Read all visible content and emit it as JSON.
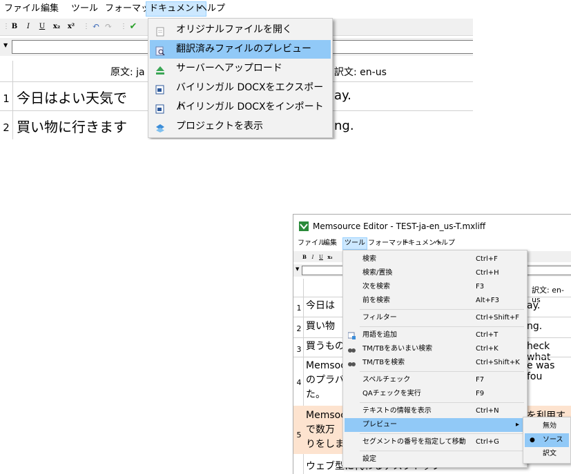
{
  "big": {
    "menubar": [
      "ファイル",
      "編集",
      "ツール",
      "フォーマット",
      "ドキュメント",
      "ヘルプ"
    ],
    "toolbar": {
      "bold": "B",
      "italic": "I",
      "underline": "U",
      "subscript": "x₂",
      "superscript": "x²"
    },
    "header": {
      "source": "原文: ja",
      "target": "訳文: en-us"
    },
    "rows": [
      {
        "num": "1",
        "source": "今日はよい天気で",
        "target": "ay."
      },
      {
        "num": "2",
        "source": "買い物に行きます",
        "target": "ng."
      }
    ],
    "menu": [
      {
        "label": "オリジナルファイルを開く",
        "icon": "document-icon"
      },
      {
        "label": "翻訳済みファイルのプレビュー",
        "icon": "preview-icon"
      },
      {
        "label": "サーバーへアップロード",
        "icon": "upload-icon"
      },
      {
        "label": "バイリンガル DOCXをエクスポート",
        "icon": "docx-export-icon"
      },
      {
        "label": "バイリンガル DOCXをインポート",
        "icon": "docx-import-icon"
      },
      {
        "label": "プロジェクトを表示",
        "icon": "project-icon"
      }
    ]
  },
  "win": {
    "title": "Memsource Editor - TEST-ja-en_us-T.mxliff",
    "menubar": [
      "ファイル",
      "編集",
      "ツール",
      "フォーマット",
      "ドキュメント",
      "ヘルプ"
    ],
    "header_target": "訳文: en-us",
    "rows": [
      {
        "num": "1",
        "source": "今日は",
        "target": "ay."
      },
      {
        "num": "2",
        "source": "買い物",
        "target": "ng."
      },
      {
        "num": "3",
        "source": "買うもの",
        "target": "heck what"
      },
      {
        "num": "4",
        "source_lines": [
          "Memsoc",
          "のプラバ",
          "た。"
        ],
        "target": "e was fou"
      },
      {
        "num": "5",
        "source_lines": [
          "Memsoc",
          "で数万",
          "りをしま"
        ],
        "target": "を利用す"
      },
      {
        "num": "",
        "source": "ウェブ型に代わるデスクトップ",
        "target": ""
      }
    ],
    "menu": [
      {
        "label": "検索",
        "shortcut": "Ctrl+F"
      },
      {
        "label": "検索/置換",
        "shortcut": "Ctrl+H"
      },
      {
        "label": "次を検索",
        "shortcut": "F3"
      },
      {
        "label": "前を検索",
        "shortcut": "Alt+F3"
      },
      {
        "label": "フィルター",
        "shortcut": "Ctrl+Shift+F"
      },
      {
        "label": "用語を追加",
        "shortcut": "Ctrl+T"
      },
      {
        "label": "TM/TBをあいまい検索",
        "shortcut": "Ctrl+K"
      },
      {
        "label": "TM/TBを検索",
        "shortcut": "Ctrl+Shift+K"
      },
      {
        "label": "スペルチェック",
        "shortcut": "F7"
      },
      {
        "label": "QAチェックを実行",
        "shortcut": "F9"
      },
      {
        "label": "テキストの情報を表示",
        "shortcut": "Ctrl+N"
      },
      {
        "label": "プレビュー",
        "shortcut": "▸"
      },
      {
        "label": "セグメントの番号を指定して移動",
        "shortcut": "Ctrl+G"
      },
      {
        "label": "設定",
        "shortcut": ""
      }
    ],
    "submenu": [
      "無効",
      "ソース",
      "訳文"
    ],
    "submenu_selected_mark": "●"
  }
}
